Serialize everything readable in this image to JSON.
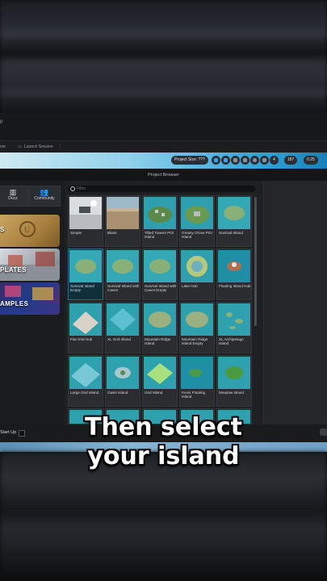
{
  "menu": {
    "left_fragment": "rse",
    "launch_session": "Launch Session",
    "kebab": "⋮",
    "top_fragment": "p"
  },
  "toolbar": {
    "project_size": "Project Size: ???",
    "counter_a": "4",
    "counter_b": "187",
    "counter_c": "0.25"
  },
  "project_browser": {
    "title": "Project Browser",
    "filter_placeholder": "Filter",
    "left_buttons": [
      {
        "label": "Docs",
        "icon": "book-icon"
      },
      {
        "label": "Community",
        "icon": "people-icon"
      }
    ],
    "categories": [
      "S",
      "PLATES",
      "AMPLES"
    ],
    "tiles": [
      {
        "label": "Simple"
      },
      {
        "label": "Blank"
      },
      {
        "label": "Tilted Towers POI Island"
      },
      {
        "label": "Greasy Grove POI Island"
      },
      {
        "label": "Survival Island"
      },
      {
        "label": "Survival Island Empty"
      },
      {
        "label": "Survival Island with Caves"
      },
      {
        "label": "Survival Island with Caves Empty"
      },
      {
        "label": "Lake Hub"
      },
      {
        "label": "Floating Island Hub"
      },
      {
        "label": "Flat Grid Hub"
      },
      {
        "label": "XL Grid Island"
      },
      {
        "label": "Mountain Ridge Island"
      },
      {
        "label": "Mountain Ridge Island Empty"
      },
      {
        "label": "XL Archipelago Island"
      },
      {
        "label": "Large Grid Island"
      },
      {
        "label": "Oasis Island"
      },
      {
        "label": "Grid Island"
      },
      {
        "label": "Kevin Floating Island"
      },
      {
        "label": "Meadow Island"
      }
    ],
    "selected_index": 5
  },
  "bottom": {
    "startup_label": "Start Up"
  },
  "caption": {
    "line1": "Then select",
    "line2": "your island"
  }
}
